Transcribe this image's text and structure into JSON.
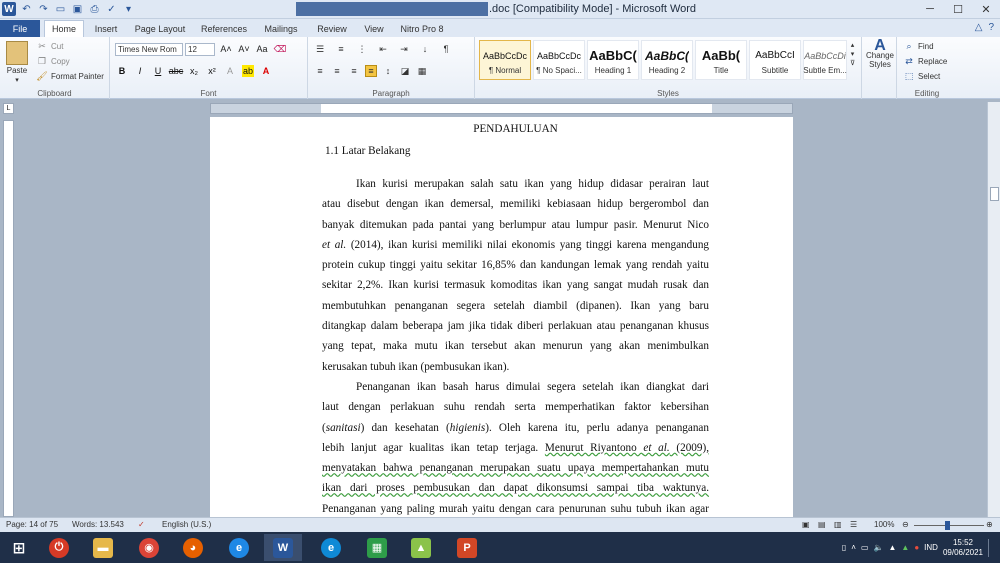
{
  "titlebar": {
    "title": ".doc [Compatibility Mode]  -  Microsoft Word"
  },
  "tabs": [
    "File",
    "Home",
    "Insert",
    "Page Layout",
    "References",
    "Mailings",
    "Review",
    "View",
    "Nitro Pro 8"
  ],
  "ribbon": {
    "clipboard": {
      "paste": "Paste",
      "cut": "Cut",
      "copy": "Copy",
      "format_painter": "Format Painter",
      "label": "Clipboard"
    },
    "font": {
      "name": "Times New Rom",
      "size": "12",
      "label": "Font"
    },
    "paragraph": {
      "label": "Paragraph"
    },
    "styles": {
      "label": "Styles",
      "items": [
        {
          "sample": "AaBbCcDc",
          "name": "¶ Normal"
        },
        {
          "sample": "AaBbCcDc",
          "name": "¶ No Spaci..."
        },
        {
          "sample": "AaBbC(",
          "name": "Heading 1"
        },
        {
          "sample": "AaBbC(",
          "name": "Heading 2"
        },
        {
          "sample": "AaBb(",
          "name": "Title"
        },
        {
          "sample": "AaBbCcI",
          "name": "Subtitle"
        },
        {
          "sample": "AaBbCcDi",
          "name": "Subtle Em..."
        }
      ],
      "change_styles": "Change Styles"
    },
    "editing": {
      "find": "Find",
      "replace": "Replace",
      "select": "Select",
      "label": "Editing"
    }
  },
  "document": {
    "heading": "PENDAHULUAN",
    "subheading": "1.1 Latar Belakang",
    "p1": {
      "l1": "Ikan kurisi merupakan salah satu ikan yang hidup didasar perairan laut",
      "l2": "atau disebut dengan ikan demersal, memiliki kebiasaan hidup bergerombol dan",
      "l3": "banyak ditemukan pada pantai yang berlumpur atau lumpur pasir. Menurut Nico",
      "l4a": "et al.",
      "l4b": " (2014), ikan kurisi memiliki nilai ekonomis yang tinggi karena mengandung",
      "l5": "protein cukup tinggi yaitu sekitar 16,85% dan kandungan lemak yang rendah yaitu",
      "l6": "sekitar 2,2%. Ikan kurisi termasuk komoditas ikan yang sangat mudah rusak dan",
      "l7": "membutuhkan penanganan segera setelah diambil (dipanen). Ikan yang baru",
      "l8": "ditangkap dalam beberapa jam jika tidak diberi perlakuan atau penanganan khusus",
      "l9": "yang tepat, maka mutu ikan tersebut akan menurun yang akan menimbulkan",
      "l10": "kerusakan tubuh ikan (pembusukan ikan)."
    },
    "p2": {
      "l1": "Penanganan ikan basah harus dimulai segera setelah ikan diangkat dari",
      "l2": "laut dengan perlakuan suhu rendah serta memperhatikan faktor kebersihan",
      "l3a": "(",
      "l3b": "sanitasi",
      "l3c": ") dan kesehatan (",
      "l3d": "higienis",
      "l3e": ").  Oleh karena itu, perlu adanya penanganan",
      "l4a": "lebih lanjut agar kualitas ikan tetap terjaga. ",
      "l4b": "Menurut Riyantono ",
      "l4c": "et al.",
      "l4d": " (2009),",
      "l5": "menyatakan bahwa penanganan merupakan suatu upaya mempertahankan mutu",
      "l6": "ikan dari proses pembusukan dan dapat dikonsumsi sampai tiba waktunya.",
      "l7": "Penanganan yang paling murah yaitu dengan cara penurunan suhu tubuh ikan agar"
    }
  },
  "statusbar": {
    "page": "Page: 14 of 75",
    "words": "Words: 13.543",
    "language": "English (U.S.)",
    "zoom": "100%"
  },
  "taskbar": {
    "lang": "IND",
    "time": "15:52",
    "date": "09/06/2021"
  }
}
